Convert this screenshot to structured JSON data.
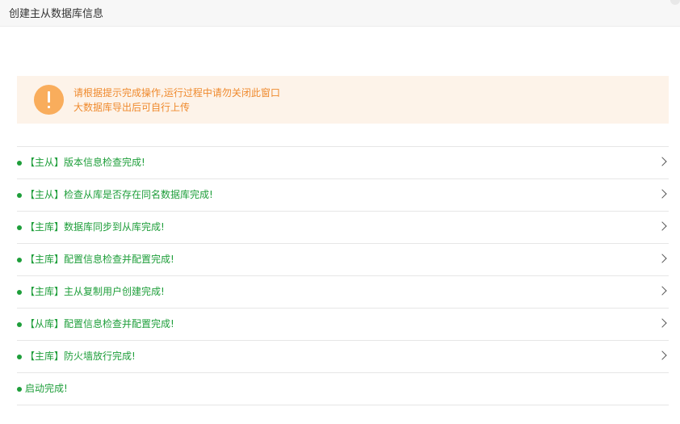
{
  "window": {
    "title": "创建主从数据库信息"
  },
  "notice": {
    "icon": "warning-icon",
    "accent_color": "#f9ad5c",
    "text_color": "#ef8a2d",
    "lines": [
      "请根据提示完成操作,运行过程中请勿关闭此窗口",
      "大数据库导出后可自行上传"
    ]
  },
  "steps": {
    "status_color": "#1e9e3a",
    "items": [
      {
        "label": "【主从】版本信息检查完成!",
        "expandable": true
      },
      {
        "label": "【主从】检查从库是否存在同名数据库完成!",
        "expandable": true
      },
      {
        "label": "【主库】数据库同步到从库完成!",
        "expandable": true
      },
      {
        "label": "【主库】配置信息检查并配置完成!",
        "expandable": true
      },
      {
        "label": "【主库】主从复制用户创建完成!",
        "expandable": true
      },
      {
        "label": "【从库】配置信息检查并配置完成!",
        "expandable": true
      },
      {
        "label": "【主库】防火墙放行完成!",
        "expandable": true
      },
      {
        "label": "启动完成!",
        "expandable": false
      }
    ]
  }
}
